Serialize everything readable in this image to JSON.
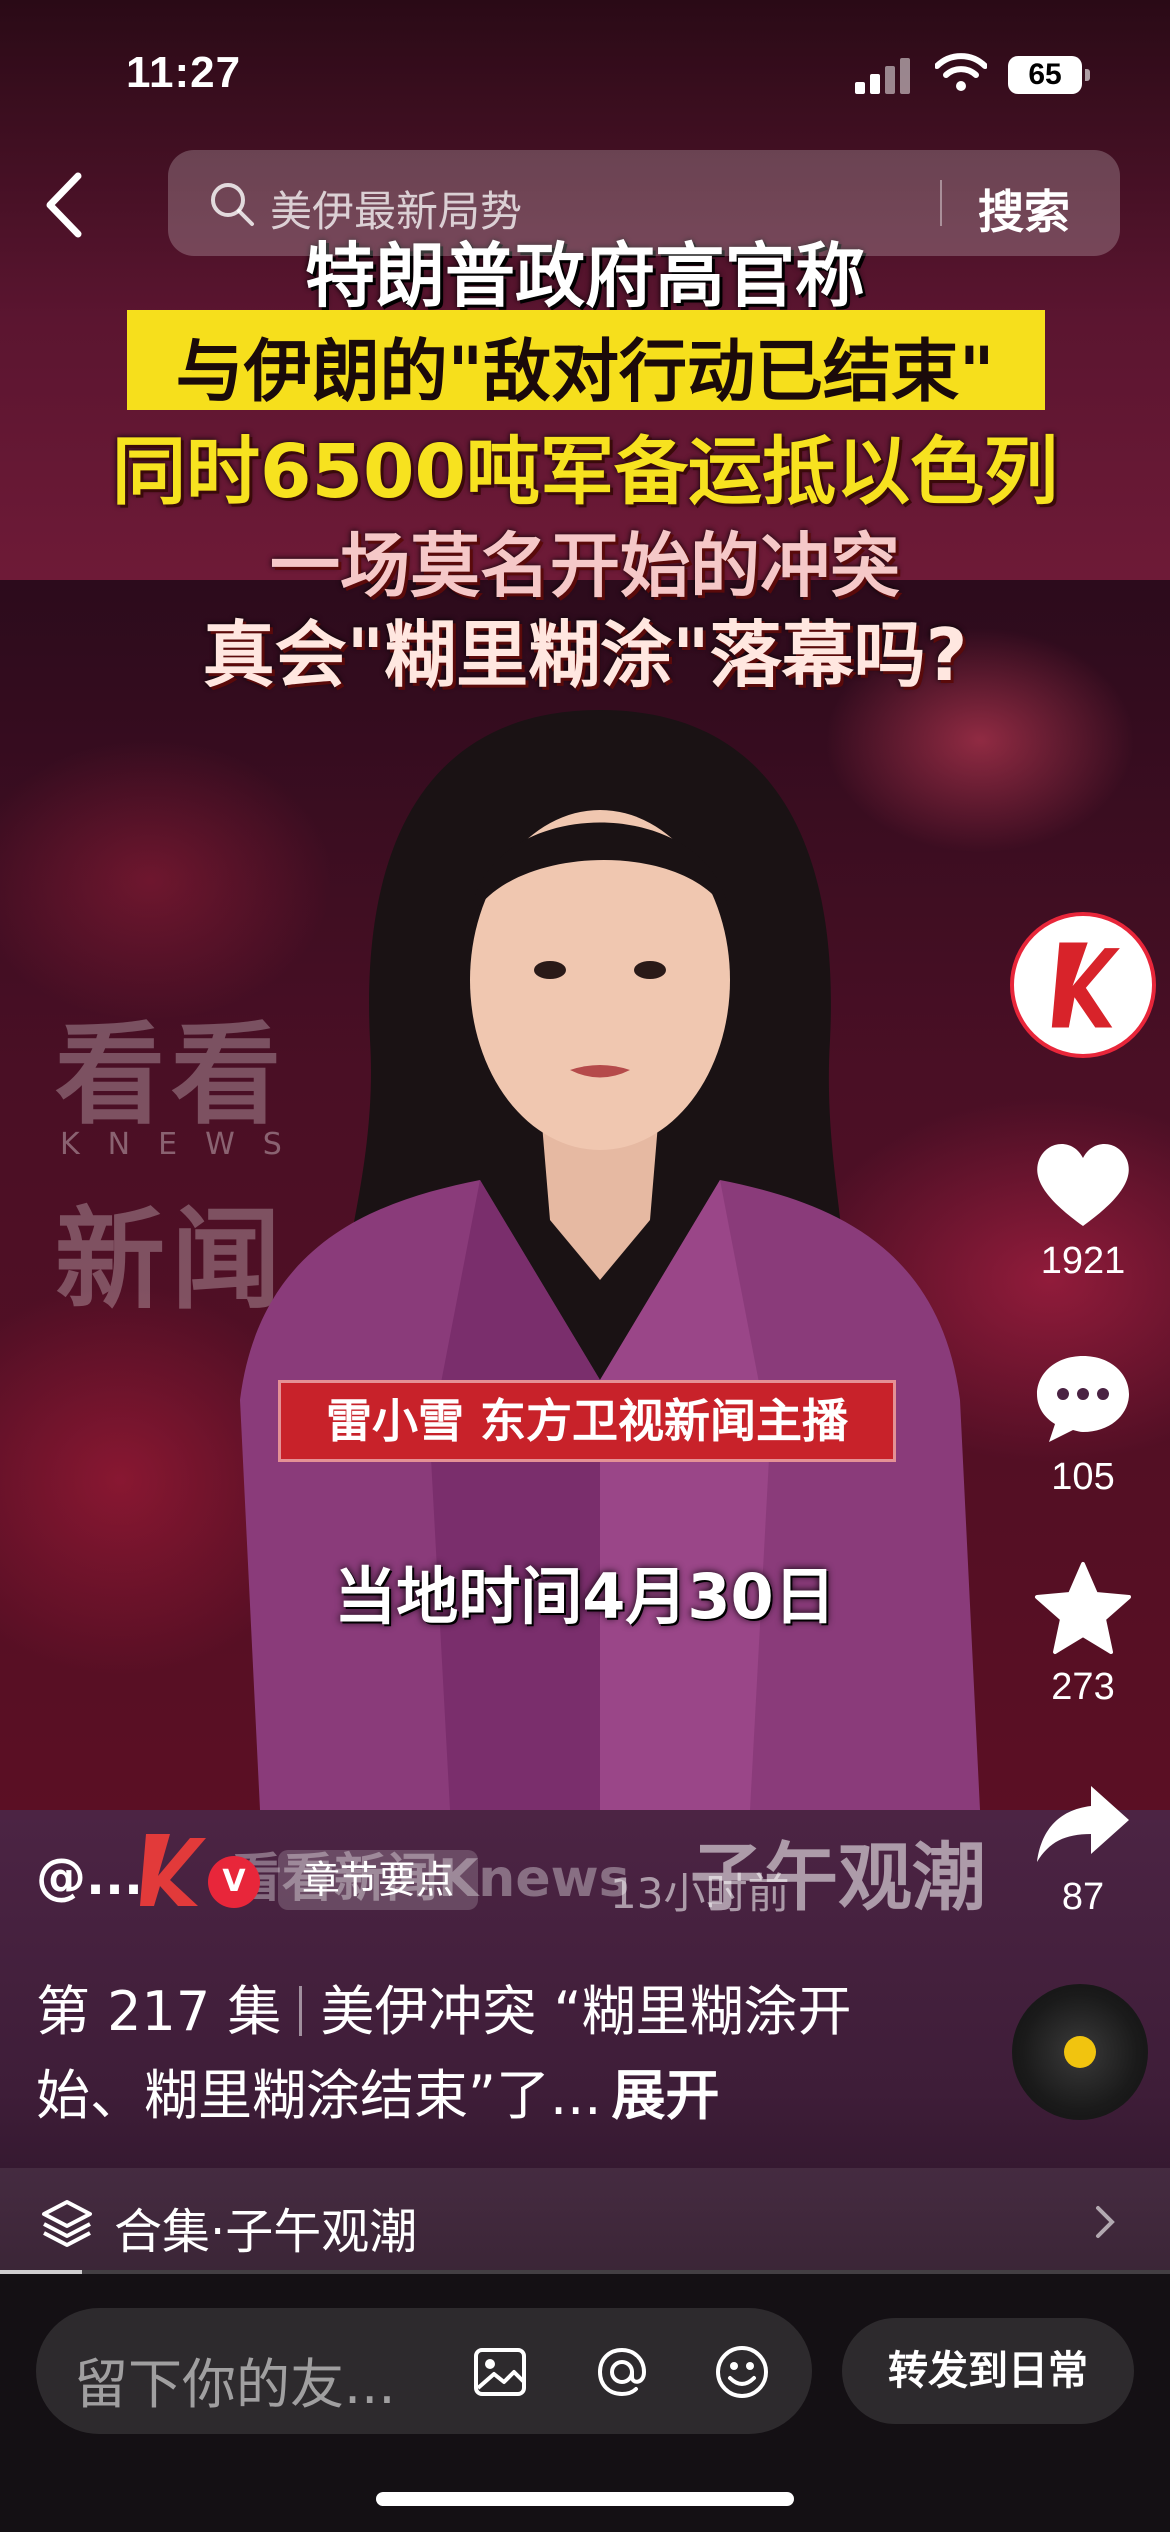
{
  "status_bar": {
    "time": "11:27",
    "battery": "65"
  },
  "search": {
    "query": "美伊最新局势",
    "button_label": "搜索"
  },
  "headline": {
    "line1": "特朗普政府高官称",
    "line2": "与伊朗的\"敌对行动已结束\"",
    "line3": "同时6500吨军备运抵以色列",
    "line4": "一场莫名开始的冲突",
    "line5": "真会\"糊里糊涂\"落幕吗?"
  },
  "watermark": {
    "line1": "看看",
    "line2": "KNEWS",
    "line3": "新闻"
  },
  "video": {
    "anchor_banner": "雷小雪  东方卫视新闻主播",
    "date_caption": "当地时间4月30日"
  },
  "actions": {
    "likes": "1921",
    "comments": "105",
    "favorites": "273",
    "shares": "87"
  },
  "author": {
    "handle": "@...",
    "chapter_label": "章节要点",
    "time_ago": "13小时前",
    "overlay_brand": "看看新闻Knews",
    "program_brand": "子午观潮"
  },
  "description": {
    "episode": "第 217 集",
    "text": "美伊冲突 “糊里糊涂开始、糊里糊涂结束”了...",
    "expand_label": "展开"
  },
  "collection": {
    "label": "合集·子午观潮"
  },
  "playback": {
    "progress_percent": 7
  },
  "comment_bar": {
    "placeholder": "留下你的友...",
    "forward_label": "转发到日常"
  }
}
